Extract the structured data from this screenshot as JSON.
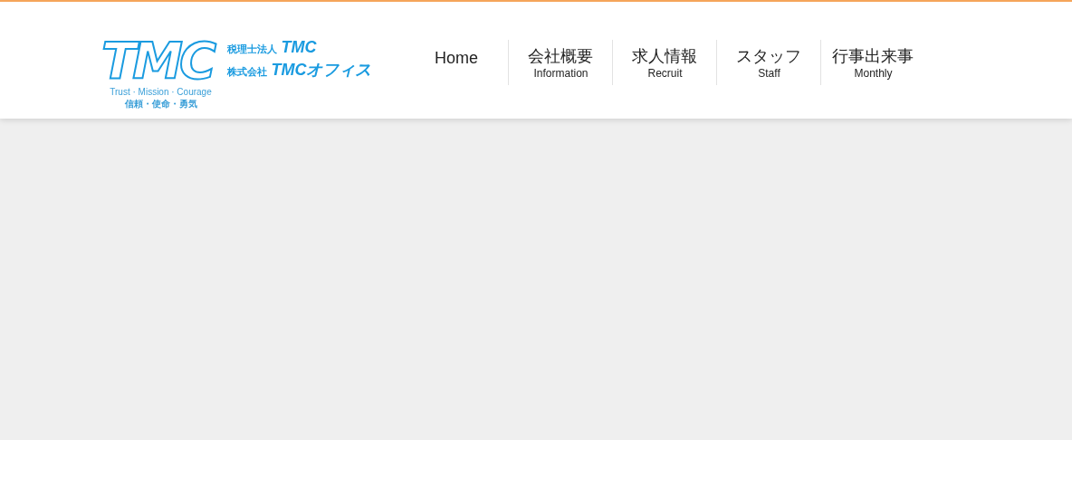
{
  "logo": {
    "mark": "TMC",
    "motto_en": "Trust · Mission · Courage",
    "motto_ja": "信頼・使命・勇気",
    "company_lines": [
      {
        "prefix": "税理士法人",
        "name": "TMC"
      },
      {
        "prefix": "株式会社",
        "name": "TMCオフィス"
      }
    ]
  },
  "nav": [
    {
      "label": "Home"
    },
    {
      "label": "会社概要",
      "sublabel": "Information"
    },
    {
      "label": "求人情報",
      "sublabel": "Recruit"
    },
    {
      "label": "スタッフ",
      "sublabel": "Staff"
    },
    {
      "label": "行事出来事",
      "sublabel": "Monthly"
    }
  ]
}
